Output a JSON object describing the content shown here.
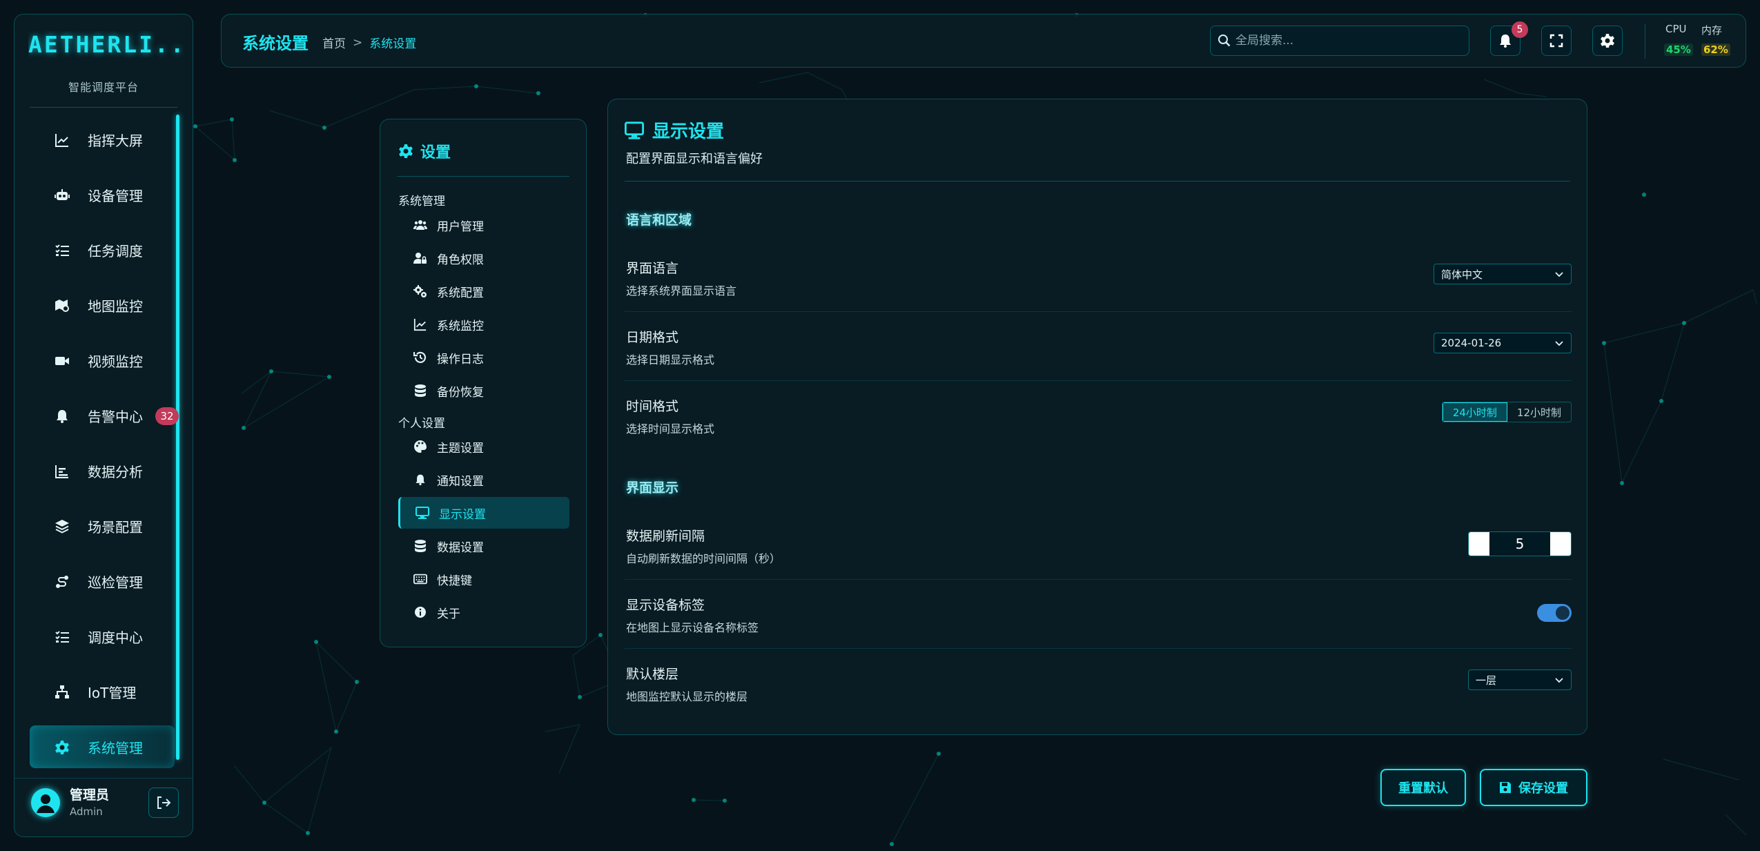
{
  "brand": {
    "logo": "AETHERLI...",
    "subtitle": "智能调度平台"
  },
  "sidebar": {
    "items": [
      {
        "label": "指挥大屏",
        "icon": "chart-line-icon"
      },
      {
        "label": "设备管理",
        "icon": "robot-icon"
      },
      {
        "label": "任务调度",
        "icon": "task-list-icon"
      },
      {
        "label": "地图监控",
        "icon": "map-pin-icon"
      },
      {
        "label": "视频监控",
        "icon": "video-camera-icon"
      },
      {
        "label": "告警中心",
        "icon": "bell-icon",
        "badge": "32"
      },
      {
        "label": "数据分析",
        "icon": "bar-chart-icon"
      },
      {
        "label": "场景配置",
        "icon": "layers-icon"
      },
      {
        "label": "巡检管理",
        "icon": "route-icon"
      },
      {
        "label": "调度中心",
        "icon": "task-list-icon"
      },
      {
        "label": "IoT管理",
        "icon": "network-icon"
      },
      {
        "label": "系统管理",
        "icon": "gear-icon",
        "active": true
      }
    ],
    "user": {
      "name": "管理员",
      "role": "Admin"
    }
  },
  "header": {
    "title": "系统设置",
    "breadcrumb": {
      "home": "首页",
      "separator": ">",
      "current": "系统设置"
    },
    "search_placeholder": "全局搜索...",
    "notifications": "5",
    "cpu": {
      "label": "CPU",
      "value": "45%",
      "color": "#22d36b"
    },
    "memory": {
      "label": "内存",
      "value": "62%",
      "color": "#f0d020"
    }
  },
  "menu": {
    "title": "设置",
    "groups": [
      {
        "label": "系统管理",
        "items": [
          {
            "label": "用户管理",
            "icon": "users-icon"
          },
          {
            "label": "角色权限",
            "icon": "user-lock-icon"
          },
          {
            "label": "系统配置",
            "icon": "cogs-icon"
          },
          {
            "label": "系统监控",
            "icon": "chart-line-icon"
          },
          {
            "label": "操作日志",
            "icon": "history-icon"
          },
          {
            "label": "备份恢复",
            "icon": "database-icon"
          }
        ]
      },
      {
        "label": "个人设置",
        "items": [
          {
            "label": "主题设置",
            "icon": "palette-icon"
          },
          {
            "label": "通知设置",
            "icon": "bell-icon"
          },
          {
            "label": "显示设置",
            "icon": "desktop-icon",
            "active": true
          },
          {
            "label": "数据设置",
            "icon": "database-icon"
          },
          {
            "label": "快捷键",
            "icon": "keyboard-icon"
          },
          {
            "label": "关于",
            "icon": "info-icon"
          }
        ]
      }
    ]
  },
  "content": {
    "title": "显示设置",
    "subtitle": "配置界面显示和语言偏好",
    "sections": [
      {
        "title": "语言和区域"
      },
      {
        "title": "界面显示"
      }
    ],
    "language": {
      "label": "界面语言",
      "desc": "选择系统界面显示语言",
      "value": "简体中文"
    },
    "date_format": {
      "label": "日期格式",
      "desc": "选择日期显示格式",
      "value": "2024-01-26"
    },
    "time_format": {
      "label": "时间格式",
      "desc": "选择时间显示格式",
      "options": [
        "24小时制",
        "12小时制"
      ],
      "selected": "24小时制"
    },
    "refresh": {
      "label": "数据刷新间隔",
      "desc": "自动刷新数据的时间间隔（秒）",
      "value": "5"
    },
    "device_labels": {
      "label": "显示设备标签",
      "desc": "在地图上显示设备名称标签",
      "on": true
    },
    "default_floor": {
      "label": "默认楼层",
      "desc": "地图监控默认显示的楼层",
      "value": "一层"
    }
  },
  "footer": {
    "reset": "重置默认",
    "save": "保存设置"
  },
  "colors": {
    "accent": "#1ee4ef",
    "background": "#07131a",
    "badge": "#c33a5a",
    "toggle": "#3b8fe0"
  }
}
